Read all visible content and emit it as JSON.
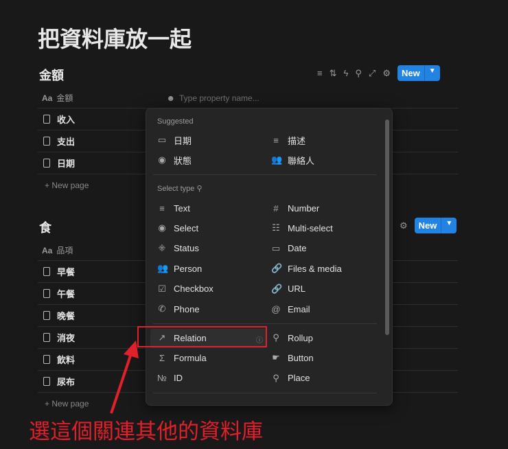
{
  "page": {
    "title": "把資料庫放一起"
  },
  "db1": {
    "title": "金額",
    "column": "金額",
    "column_icon": "Aa",
    "rows": [
      "收入",
      "支出",
      "日期"
    ],
    "new_page": "+ New page",
    "new_label": "New",
    "property_placeholder": "Type property name..."
  },
  "db2": {
    "title": "食",
    "column": "品項",
    "column_icon": "Aa",
    "rows": [
      "早餐",
      "午餐",
      "晚餐",
      "消夜",
      "飲料",
      "尿布"
    ],
    "new_page": "+ New page",
    "new_label": "New"
  },
  "menu": {
    "suggested_label": "Suggested",
    "suggested": [
      {
        "label": "日期",
        "icon": "calendar-icon"
      },
      {
        "label": "描述",
        "icon": "text-icon"
      },
      {
        "label": "狀態",
        "icon": "select-icon"
      },
      {
        "label": "聯絡人",
        "icon": "person-icon"
      }
    ],
    "select_type_label": "Select type",
    "types": [
      {
        "label": "Text"
      },
      {
        "label": "Number"
      },
      {
        "label": "Select"
      },
      {
        "label": "Multi-select"
      },
      {
        "label": "Status"
      },
      {
        "label": "Date"
      },
      {
        "label": "Person"
      },
      {
        "label": "Files & media"
      },
      {
        "label": "Checkbox"
      },
      {
        "label": "URL"
      },
      {
        "label": "Phone"
      },
      {
        "label": "Email"
      }
    ],
    "types2": [
      {
        "label": "Relation"
      },
      {
        "label": "Rollup"
      },
      {
        "label": "Formula"
      },
      {
        "label": "Button"
      },
      {
        "label": "ID"
      },
      {
        "label": "Place"
      }
    ]
  },
  "annotation": {
    "text": "選這個關連其他的資料庫",
    "color": "#e0202a"
  },
  "colors": {
    "accent": "#2383e2",
    "bg": "#191919",
    "popup": "#252525"
  }
}
